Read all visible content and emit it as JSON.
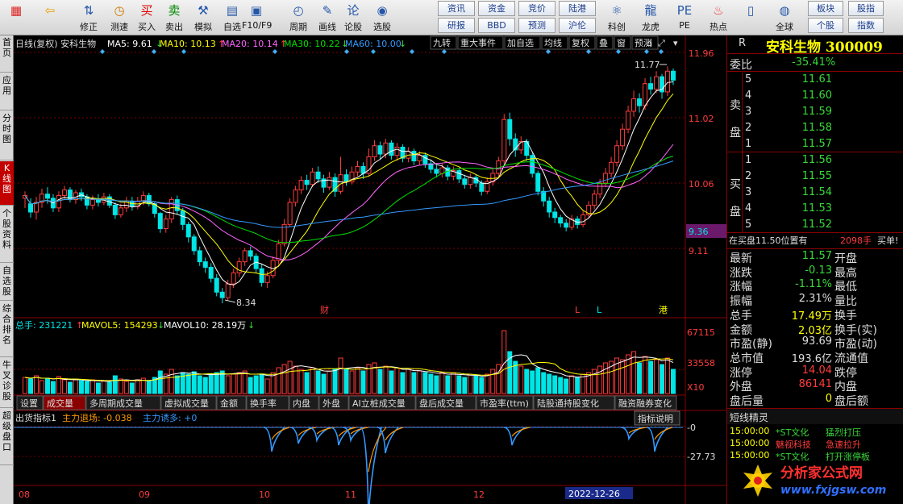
{
  "toolbar": {
    "items": [
      {
        "label": "",
        "icon": "windows-icon"
      },
      {
        "label": "",
        "icon": "back-arrow-icon"
      },
      {
        "label": "修正",
        "icon": "arrows-icon"
      },
      {
        "label": "测速",
        "icon": "clock-icon"
      },
      {
        "label": "买入",
        "icon": "buy-icon"
      },
      {
        "label": "卖出",
        "icon": "sell-icon"
      },
      {
        "label": "模拟",
        "icon": "hammer-icon"
      },
      {
        "label": "自选",
        "icon": "portfolio-icon"
      },
      {
        "label": "F10/F9",
        "icon": "f10-icon"
      },
      {
        "label": "周期",
        "icon": "period-icon"
      },
      {
        "label": "画线",
        "icon": "pencil-icon"
      },
      {
        "label": "论股",
        "icon": "discuss-icon"
      },
      {
        "label": "选股",
        "icon": "select-stock-icon"
      }
    ],
    "word_buttons": [
      "资讯",
      "资金",
      "竞价",
      "陆港",
      "研报",
      "BBD",
      "预测",
      "沪伦"
    ],
    "right_items": [
      {
        "label": "科创",
        "icon": "sci-icon"
      },
      {
        "label": "龙虎",
        "icon": "dragon-icon"
      },
      {
        "label": "PE",
        "icon": "pe-icon"
      },
      {
        "label": "热点",
        "icon": "hot-icon"
      },
      {
        "label": "",
        "icon": "phone-icon"
      },
      {
        "label": "全球",
        "icon": "globe-icon"
      }
    ],
    "right_words": [
      "板块",
      "股指",
      "个股",
      "指数"
    ]
  },
  "sidebar": {
    "items": [
      "首页",
      "应用",
      "分时图",
      "K线图",
      "个股资料",
      "自选股",
      "综合排名",
      "牛叉诊股",
      "超级盘口"
    ]
  },
  "kline": {
    "header": {
      "title": "日线(复权) 安科生物",
      "ma5": "MA5: 9.61",
      "ma10": "MA10: 10.13",
      "ma20": "MA20: 10.14",
      "ma30": "MA30: 10.22",
      "ma60": "MA60: 10.00"
    },
    "tabs": [
      "九转",
      "重大事件",
      "加自选",
      "均线",
      "复权",
      "叠",
      "窗",
      "预测"
    ],
    "price_labels": [
      "11.96",
      "11.02",
      "10.06",
      "9.36",
      "9.11"
    ],
    "max_label": "11.77",
    "min_label": "8.34",
    "markers": [
      "财",
      "L",
      "L",
      "港"
    ]
  },
  "volume": {
    "header": {
      "total": "总手: 231221",
      "mavol5": "MAVOL5: 154293",
      "mavol10": "MAVOL10: 28.19万"
    },
    "labels": [
      "67115",
      "33558",
      "X10"
    ]
  },
  "bottom_tabs": [
    "设置",
    "成交量",
    "多周期成交量",
    "虚拟成交量",
    "金额",
    "换手率",
    "内盘",
    "外盘",
    "AI立桩成交量",
    "盘后成交量",
    "市盈率(ttm)",
    "陆股通持股变化",
    "融资融券变化"
  ],
  "indicator": {
    "header": {
      "name": "出货指标1",
      "a": "主力退场: -0.038",
      "b": "主力诱多: +0"
    },
    "button": "指标说明",
    "labels": [
      "-0",
      "-27.73"
    ]
  },
  "dates": {
    "months": [
      "08",
      "09",
      "10",
      "11",
      "12"
    ],
    "cursor": "2022-12-26"
  },
  "colors": {
    "up": "#ff3c3c",
    "down": "#00e5e5",
    "ma5": "#ffffff",
    "ma10": "#ffff00",
    "ma20": "#ff66ff",
    "ma30": "#00e000",
    "ma60": "#3399ff"
  },
  "quote": {
    "r": "R",
    "name": "安科生物 300009",
    "weibi": {
      "label": "委比",
      "value": "-35.41%"
    },
    "sell": [
      {
        "n": "5",
        "p": "11.61"
      },
      {
        "n": "4",
        "p": "11.60"
      },
      {
        "n": "3",
        "p": "11.59"
      },
      {
        "n": "2",
        "p": "11.58"
      },
      {
        "n": "1",
        "p": "11.57"
      }
    ],
    "buy": [
      {
        "n": "1",
        "p": "11.56"
      },
      {
        "n": "2",
        "p": "11.55"
      },
      {
        "n": "3",
        "p": "11.54"
      },
      {
        "n": "4",
        "p": "11.53"
      },
      {
        "n": "5",
        "p": "11.52"
      }
    ],
    "sell_label": "卖盘",
    "buy_label": "买盘",
    "notice": {
      "text": "在买盘11.50位置有",
      "qty": "2098手",
      "tail": "买单!"
    },
    "stats": [
      {
        "l": "最新",
        "v": "11.57",
        "c": "grn",
        "l2": "开盘"
      },
      {
        "l": "涨跌",
        "v": "-0.13",
        "c": "grn",
        "l2": "最高"
      },
      {
        "l": "涨幅",
        "v": "-1.11%",
        "c": "grn",
        "l2": "最低"
      },
      {
        "l": "振幅",
        "v": "2.31%",
        "c": "wht",
        "l2": "量比"
      },
      {
        "l": "总手",
        "v": "17.49万",
        "c": "yel",
        "l2": "换手"
      },
      {
        "l": "金额",
        "v": "2.03亿",
        "c": "yel",
        "l2": "换手(实)"
      },
      {
        "l": "市盈(静)",
        "v": "93.69",
        "c": "wht",
        "l2": "市盈(动)"
      },
      {
        "l": "总市值",
        "v": "193.6亿",
        "c": "wht",
        "l2": "流通值"
      },
      {
        "l": "涨停",
        "v": "14.04",
        "c": "red",
        "l2": "跌停"
      },
      {
        "l": "外盘",
        "v": "86141",
        "c": "red",
        "l2": "内盘"
      },
      {
        "l": "盘后量",
        "v": "0",
        "c": "yel",
        "l2": "盘后额"
      }
    ]
  },
  "sprite": {
    "title": "短线精灵",
    "rows": [
      {
        "t": "15:00:00",
        "n": "*ST文化",
        "e": "猛烈打压"
      },
      {
        "t": "15:00:00",
        "n": "魅视科技",
        "e": "急速拉升"
      },
      {
        "t": "15:00:00",
        "n": "*ST文化",
        "e": "打开涨停板"
      }
    ]
  },
  "watermark": {
    "text": "分析家公式网",
    "url": "www.fxjgsw.com"
  }
}
